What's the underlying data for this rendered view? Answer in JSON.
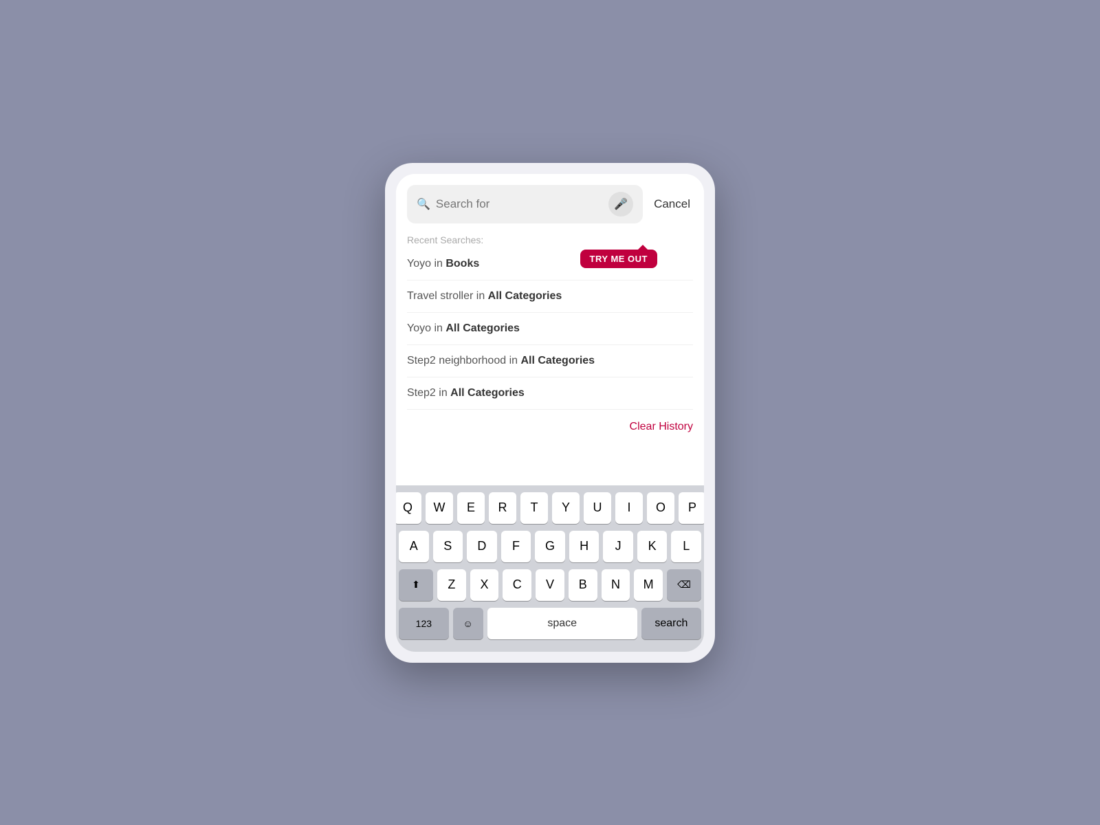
{
  "background_color": "#8b8fa8",
  "search": {
    "placeholder": "Search for",
    "cancel_label": "Cancel",
    "mic_label": "microphone",
    "try_me_label": "TRY ME OUT"
  },
  "recent": {
    "section_label": "Recent Searches:",
    "items": [
      {
        "normal": "Yoyo in ",
        "bold": "Books"
      },
      {
        "normal": "Travel stroller in ",
        "bold": "All Categories"
      },
      {
        "normal": "Yoyo in ",
        "bold": "All Categories"
      },
      {
        "normal": "Step2 neighborhood in ",
        "bold": "All Categories"
      },
      {
        "normal": "Step2 in ",
        "bold": "All Categories"
      }
    ],
    "clear_label": "Clear History"
  },
  "keyboard": {
    "rows": [
      [
        "Q",
        "W",
        "E",
        "R",
        "T",
        "Y",
        "U",
        "I",
        "O",
        "P"
      ],
      [
        "A",
        "S",
        "D",
        "F",
        "G",
        "H",
        "J",
        "K",
        "L"
      ],
      [
        "Z",
        "X",
        "C",
        "V",
        "B",
        "N",
        "M"
      ]
    ],
    "special": {
      "numbers": "123",
      "emoji": "☺",
      "space": "space",
      "search": "search",
      "shift": "⬆",
      "backspace": "⌫"
    }
  }
}
